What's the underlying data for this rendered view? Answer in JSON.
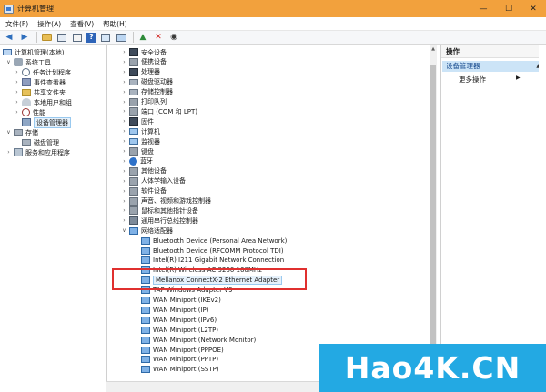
{
  "window": {
    "title": "计算机管理",
    "minimize_glyph": "—",
    "maximize_glyph": "☐",
    "close_glyph": "✕"
  },
  "menu": [
    "文件(F)",
    "操作(A)",
    "查看(V)",
    "帮助(H)"
  ],
  "toolbar": {
    "icons": [
      "back-arrow-icon",
      "forward-arrow-icon",
      "up-folder-icon",
      "show-hide-tree-icon",
      "properties-icon",
      "help-icon",
      "console-view-icon",
      "enable-device-icon",
      "uninstall-device-icon",
      "update-driver-icon"
    ]
  },
  "left_tree": {
    "root": "计算机管理(本地)",
    "system_tools": "系统工具",
    "task_scheduler": "任务计划程序",
    "event_viewer": "事件查看器",
    "shared_folders": "共享文件夹",
    "local_users": "本地用户和组",
    "performance": "性能",
    "device_manager": "设备管理器",
    "storage": "存储",
    "disk_management": "磁盘管理",
    "services_apps": "服务和应用程序"
  },
  "device_tree": {
    "categories": [
      "安全设备",
      "便携设备",
      "处理器",
      "磁盘驱动器",
      "存储控制器",
      "打印队列",
      "端口 (COM 和 LPT)",
      "固件",
      "计算机",
      "监视器",
      "键盘",
      "蓝牙",
      "其他设备",
      "人体学输入设备",
      "软件设备",
      "声音、视频和游戏控制器",
      "鼠标和其他指针设备",
      "通用串行总线控制器",
      "网络适配器"
    ],
    "network_adapters": [
      "Bluetooth Device (Personal Area Network)",
      "Bluetooth Device (RFCOMM Protocol TDI)",
      "Intel(R) I211 Gigabit Network Connection",
      "Intel(R) Wireless-AC 9260 160MHz",
      "Mellanox ConnectX-2 Ethernet Adapter",
      "TAP-Windows Adapter V9",
      "WAN Miniport (IKEv2)",
      "WAN Miniport (IP)",
      "WAN Miniport (IPv6)",
      "WAN Miniport (L2TP)",
      "WAN Miniport (Network Monitor)",
      "WAN Miniport (PPPOE)",
      "WAN Miniport (PPTP)",
      "WAN Miniport (SSTP)"
    ]
  },
  "actions": {
    "header": "操作",
    "section": "设备管理器",
    "more": "更多操作"
  },
  "watermark": {
    "text": "Hao4K.CN"
  },
  "colors": {
    "titlebar": "#f2a13d",
    "selection": "#cce4f7",
    "highlight_box": "#e0302f",
    "watermark_bg": "#23a9e3"
  }
}
